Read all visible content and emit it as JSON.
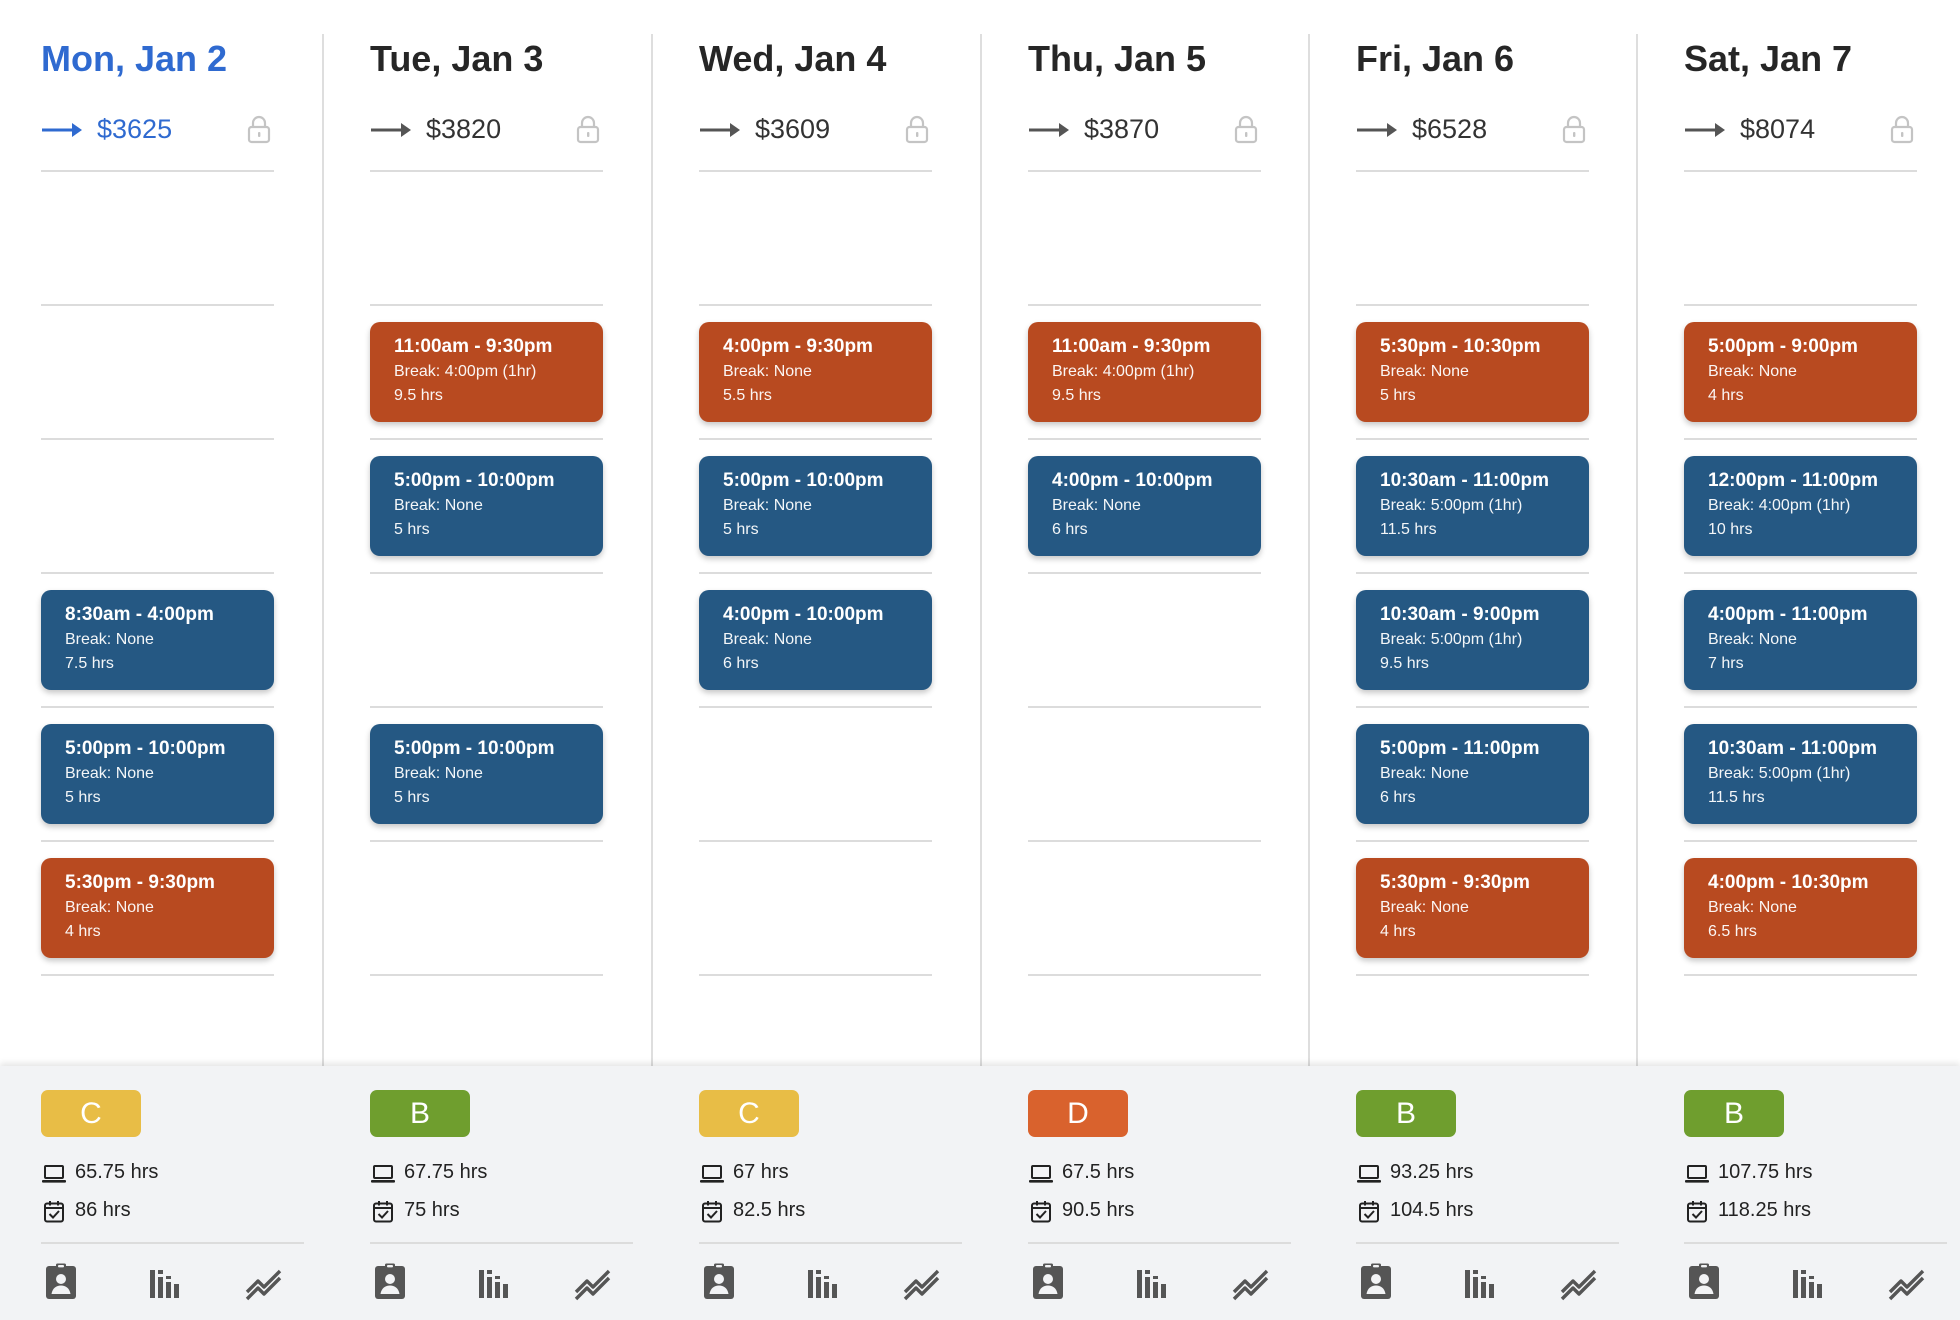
{
  "colors": {
    "today": "#2f6ad0",
    "shift_blue": "#255883",
    "shift_orange": "#b84a20",
    "grade_C": "#e8bd46",
    "grade_B": "#6f9e2e",
    "grade_D": "#d9622d",
    "icon_gray": "#555555"
  },
  "days": [
    {
      "title": "Mon, Jan 2",
      "today": true,
      "cost": "$3625",
      "slots": [
        null,
        null,
        null,
        {
          "color": "blue",
          "time": "8:30am - 4:00pm",
          "break": "Break: None",
          "hours": "7.5 hrs"
        },
        {
          "color": "blue",
          "time": "5:00pm - 10:00pm",
          "break": "Break: None",
          "hours": "5 hrs"
        },
        {
          "color": "orange",
          "time": "5:30pm - 9:30pm",
          "break": "Break: None",
          "hours": "4 hrs"
        }
      ],
      "grade": "C",
      "scheduled_hours": "65.75 hrs",
      "planned_hours": "86 hrs"
    },
    {
      "title": "Tue, Jan 3",
      "today": false,
      "cost": "$3820",
      "slots": [
        null,
        {
          "color": "orange",
          "time": "11:00am - 9:30pm",
          "break": "Break: 4:00pm (1hr)",
          "hours": "9.5 hrs"
        },
        {
          "color": "blue",
          "time": "5:00pm - 10:00pm",
          "break": "Break: None",
          "hours": "5 hrs"
        },
        null,
        {
          "color": "blue",
          "time": "5:00pm - 10:00pm",
          "break": "Break: None",
          "hours": "5 hrs"
        },
        null
      ],
      "grade": "B",
      "scheduled_hours": "67.75 hrs",
      "planned_hours": "75 hrs"
    },
    {
      "title": "Wed, Jan 4",
      "today": false,
      "cost": "$3609",
      "slots": [
        null,
        {
          "color": "orange",
          "time": "4:00pm - 9:30pm",
          "break": "Break: None",
          "hours": "5.5 hrs"
        },
        {
          "color": "blue",
          "time": "5:00pm - 10:00pm",
          "break": "Break: None",
          "hours": "5 hrs"
        },
        {
          "color": "blue",
          "time": "4:00pm - 10:00pm",
          "break": "Break: None",
          "hours": "6 hrs"
        },
        null,
        null
      ],
      "grade": "C",
      "scheduled_hours": "67 hrs",
      "planned_hours": "82.5 hrs"
    },
    {
      "title": "Thu, Jan 5",
      "today": false,
      "cost": "$3870",
      "slots": [
        null,
        {
          "color": "orange",
          "time": "11:00am - 9:30pm",
          "break": "Break: 4:00pm (1hr)",
          "hours": "9.5 hrs"
        },
        {
          "color": "blue",
          "time": "4:00pm - 10:00pm",
          "break": "Break: None",
          "hours": "6 hrs"
        },
        null,
        null,
        null
      ],
      "grade": "D",
      "scheduled_hours": "67.5 hrs",
      "planned_hours": "90.5 hrs"
    },
    {
      "title": "Fri, Jan 6",
      "today": false,
      "cost": "$6528",
      "slots": [
        null,
        {
          "color": "orange",
          "time": "5:30pm - 10:30pm",
          "break": "Break: None",
          "hours": "5 hrs"
        },
        {
          "color": "blue",
          "time": "10:30am - 11:00pm",
          "break": "Break: 5:00pm (1hr)",
          "hours": "11.5 hrs"
        },
        {
          "color": "blue",
          "time": "10:30am - 9:00pm",
          "break": "Break: 5:00pm (1hr)",
          "hours": "9.5 hrs"
        },
        {
          "color": "blue",
          "time": "5:00pm - 11:00pm",
          "break": "Break: None",
          "hours": "6 hrs"
        },
        {
          "color": "orange",
          "time": "5:30pm - 9:30pm",
          "break": "Break: None",
          "hours": "4 hrs"
        }
      ],
      "grade": "B",
      "scheduled_hours": "93.25 hrs",
      "planned_hours": "104.5 hrs"
    },
    {
      "title": "Sat, Jan 7",
      "today": false,
      "cost": "$8074",
      "slots": [
        null,
        {
          "color": "orange",
          "time": "5:00pm - 9:00pm",
          "break": "Break: None",
          "hours": "4 hrs"
        },
        {
          "color": "blue",
          "time": "12:00pm - 11:00pm",
          "break": "Break: 4:00pm (1hr)",
          "hours": "10 hrs"
        },
        {
          "color": "blue",
          "time": "4:00pm - 11:00pm",
          "break": "Break: None",
          "hours": "7 hrs"
        },
        {
          "color": "blue",
          "time": "10:30am - 11:00pm",
          "break": "Break: 5:00pm (1hr)",
          "hours": "11.5 hrs"
        },
        {
          "color": "orange",
          "time": "4:00pm - 10:30pm",
          "break": "Break: None",
          "hours": "6.5 hrs"
        }
      ],
      "grade": "B",
      "scheduled_hours": "107.75 hrs",
      "planned_hours": "118.25 hrs"
    }
  ],
  "icons": {
    "cost_trend": "arrow-right-icon",
    "lock": "lock-icon",
    "scheduled": "laptop-icon",
    "planned": "calendar-check-icon",
    "footer": [
      "employee-badge-icon",
      "bar-chart-icon",
      "trend-line-icon"
    ]
  }
}
